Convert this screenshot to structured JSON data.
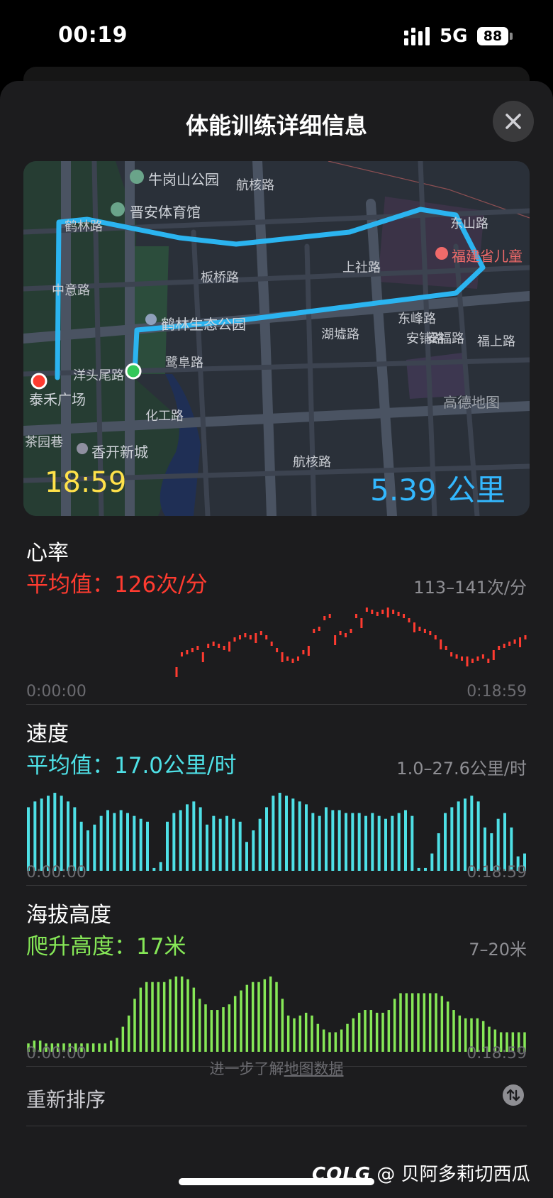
{
  "status_bar": {
    "time": "00:19",
    "network": "5G",
    "battery": "88"
  },
  "sheet": {
    "title": "体能训练详细信息"
  },
  "map": {
    "duration": "18:59",
    "distance": "5.39 公里",
    "route_color": "#2bb4f0",
    "labels": {
      "poi_niugang": "牛岗山公园",
      "poi_jinan": "晋安体育馆",
      "road_helin": "鹤林路",
      "road_hangxing": "航核路",
      "road_dongshan": "东山路",
      "poi_fujian": "福建省儿童",
      "road_shangshe": "上社路",
      "road_banqiao": "板桥路",
      "road_anfu": "安福路",
      "poi_helin_park": "鹤林生态公园",
      "road_huyu": "湖墟路",
      "road_dongfeng": "东峰路",
      "road_anpu": "安铺路",
      "road_zhongyi": "中意路",
      "road_yangtou": "洋头尾路",
      "road_fushang": "福上路",
      "road_lufu": "鹭阜路",
      "poi_taihe": "泰禾广场",
      "map_brand": "高德地图",
      "road_huagong": "化工路",
      "road_chayuan": "茶园巷",
      "poi_xiangkai": "香开新城",
      "road_hangxing2": "航核路"
    }
  },
  "heart_rate": {
    "title": "心率",
    "avg": "平均值：126次/分",
    "range": "113–141次/分",
    "start": "0:00:00",
    "end": "0:18:59",
    "color": "#ff3b30"
  },
  "speed": {
    "title": "速度",
    "avg": "平均值：17.0公里/时",
    "range": "1.0–27.6公里/时",
    "start": "0:00:00",
    "end": "0:18:59",
    "color": "#4ee0e6"
  },
  "elevation": {
    "title": "海拔高度",
    "avg": "爬升高度：17米",
    "range": "7–20米",
    "start": "0:00:00",
    "end": "0:18:59",
    "color": "#86e857"
  },
  "reorder": {
    "label": "重新排序"
  },
  "footer": {
    "prefix": "进一步了解",
    "link": "地图数据"
  },
  "watermark": {
    "logo": "COLG",
    "text": "@ 贝阿多莉切西瓜"
  },
  "chart_data": [
    {
      "type": "scatter",
      "title": "心率",
      "series": [
        {
          "values": [
            113,
            120,
            121,
            122,
            123,
            120,
            124,
            125,
            124,
            123,
            125,
            127,
            128,
            129,
            128,
            129,
            130,
            128,
            125,
            122,
            120,
            118,
            117,
            118,
            121,
            123,
            131,
            132,
            137,
            138,
            128,
            130,
            129,
            131,
            138,
            136,
            141,
            140,
            139,
            140,
            141,
            140,
            139,
            138,
            136,
            134,
            132,
            131,
            130,
            128,
            126,
            123,
            120,
            119,
            118,
            118,
            117,
            118,
            119,
            117,
            121,
            123,
            124,
            125,
            126,
            127,
            128
          ]
        }
      ],
      "x_range": [
        "0:00:00",
        "0:18:59"
      ]
    },
    {
      "type": "bar",
      "title": "速度",
      "series": [
        {
          "values": [
            22,
            24,
            25,
            26,
            27,
            26,
            24,
            22,
            17,
            14,
            16,
            19,
            21,
            20,
            21,
            20,
            19,
            18,
            17,
            1,
            3,
            17,
            20,
            21,
            23,
            24,
            22,
            16,
            19,
            18,
            19,
            18,
            17,
            10,
            14,
            18,
            22,
            26,
            27,
            26,
            25,
            24,
            23,
            20,
            19,
            22,
            21,
            21,
            20,
            20,
            20,
            19,
            20,
            19,
            18,
            19,
            20,
            21,
            19,
            1,
            1,
            6,
            13,
            20,
            22,
            24,
            25,
            26,
            24,
            15,
            13,
            18,
            20,
            15,
            5,
            6
          ]
        }
      ],
      "x_range": [
        "0:00:00",
        "0:18:59"
      ]
    },
    {
      "type": "bar",
      "title": "海拔高度",
      "series": [
        {
          "values": [
            8,
            8.5,
            8.5,
            8,
            8,
            8,
            8,
            8,
            8,
            8,
            8,
            8,
            8,
            8,
            8.5,
            9,
            11,
            13,
            16,
            18,
            19,
            19,
            19,
            19,
            19.5,
            20,
            20,
            19.5,
            18,
            16,
            15,
            14,
            14,
            14.5,
            15,
            16.5,
            17.5,
            18.5,
            19,
            19,
            19.5,
            20,
            19,
            16,
            13,
            12.5,
            13,
            13.5,
            13,
            11.5,
            10.5,
            10,
            10,
            10.5,
            11.5,
            12.5,
            13.5,
            14,
            14,
            13.5,
            13.5,
            14,
            16,
            17,
            17,
            17,
            17,
            17,
            17,
            17,
            16.5,
            15.5,
            14,
            13,
            12.5,
            12.5,
            12.5,
            12,
            11,
            10.5,
            10,
            10,
            10,
            10,
            10
          ]
        }
      ],
      "x_range": [
        "0:00:00",
        "0:18:59"
      ]
    }
  ]
}
